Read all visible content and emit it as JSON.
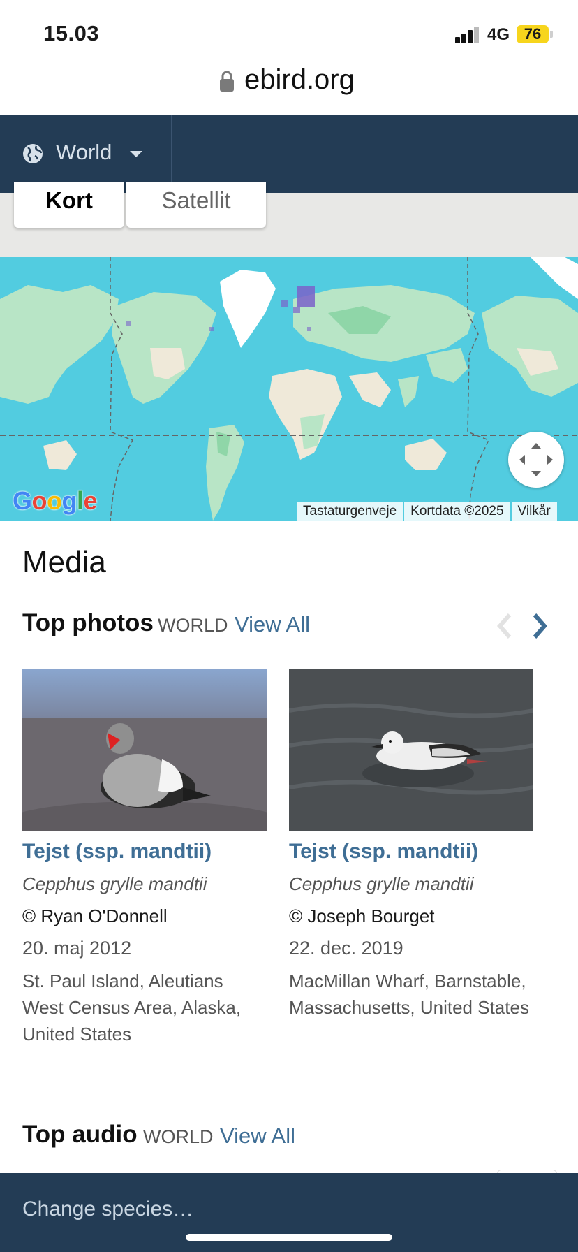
{
  "status_bar": {
    "time": "15.03",
    "network": "4G",
    "battery": "76"
  },
  "browser": {
    "url": "ebird.org"
  },
  "nav": {
    "region": "World"
  },
  "map": {
    "tabs": [
      "Kort",
      "Satellit"
    ],
    "google_logo": "Google",
    "attribution": [
      "Tastaturgenveje",
      "Kortdata ©2025",
      "Vilkår"
    ]
  },
  "media": {
    "title": "Media",
    "top_photos": {
      "heading": "Top photos",
      "scope": "WORLD",
      "view_all": "View All",
      "items": [
        {
          "name": "Tejst (ssp. mandtii)",
          "scientific": "Cepphus grylle mandtii",
          "credit": "© Ryan O'Donnell",
          "date": "20. maj 2012",
          "location": "St. Paul Island, Aleutians West Census Area, Alaska, United States"
        },
        {
          "name": "Tejst (ssp. mandtii)",
          "scientific": "Cepphus grylle mandtii",
          "credit": "© Joseph Bourget",
          "date": "22. dec. 2019",
          "location": "MacMillan Wharf, Barnstable, Massachusetts, United States"
        }
      ]
    },
    "top_audio": {
      "heading": "Top audio",
      "scope": "WORLD",
      "view_all": "View All"
    }
  },
  "bottom_bar": {
    "label": "Change species…"
  },
  "colors": {
    "nav": "#233c55",
    "link": "#3f6e95",
    "ocean": "#52cce0",
    "battery": "#f7d51d"
  },
  "icons": [
    "lock-icon",
    "globe-icon",
    "chevron-down-icon",
    "fullscreen-icon",
    "chevron-left-icon",
    "chevron-right-icon",
    "signal-icon"
  ]
}
